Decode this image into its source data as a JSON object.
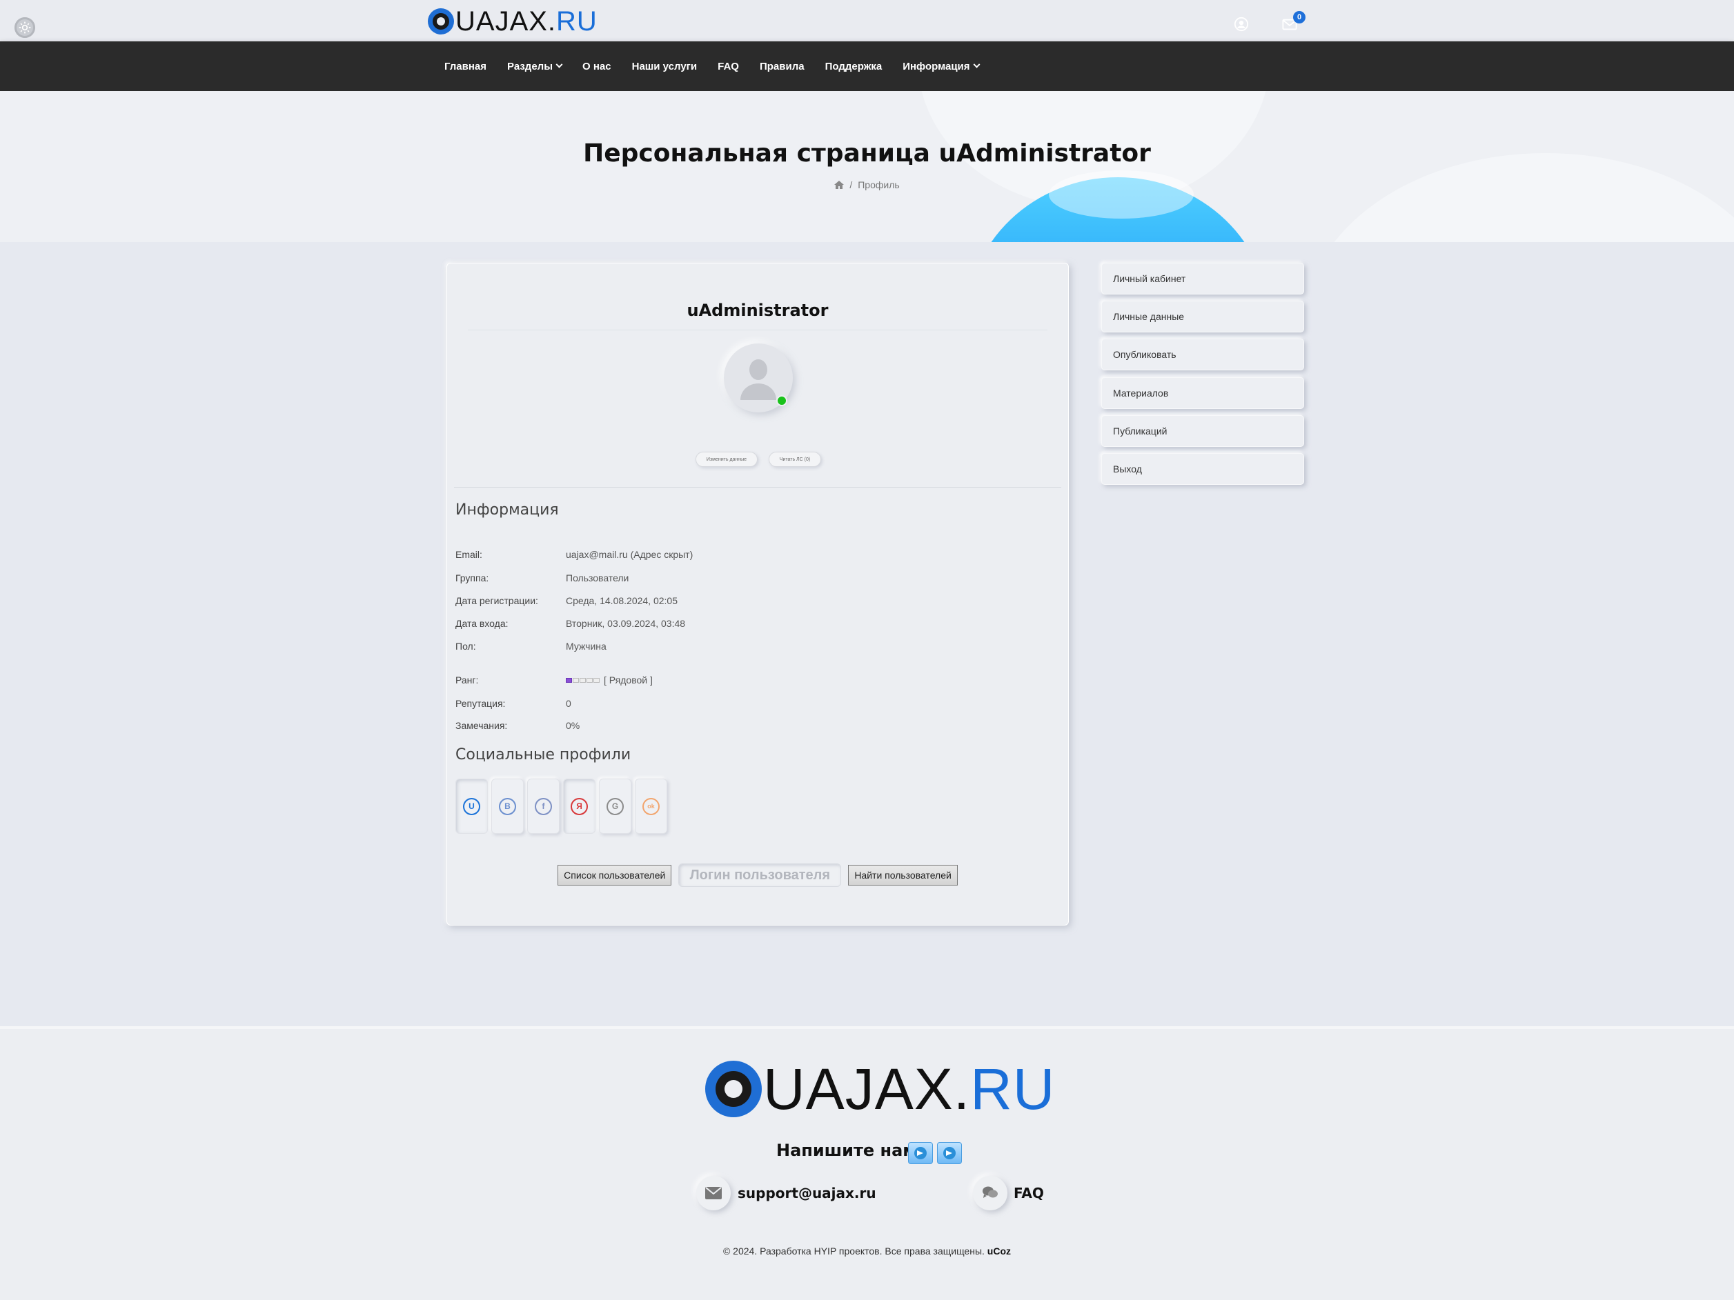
{
  "brand": {
    "name_dark": "UAJAX.",
    "name_blue": "RU"
  },
  "nav": {
    "items": [
      {
        "label": "Главная",
        "dropdown": false
      },
      {
        "label": "Разделы",
        "dropdown": true
      },
      {
        "label": "О нас",
        "dropdown": false
      },
      {
        "label": "Наши услуги",
        "dropdown": false
      },
      {
        "label": "FAQ",
        "dropdown": false
      },
      {
        "label": "Правила",
        "dropdown": false
      },
      {
        "label": "Поддержка",
        "dropdown": false
      },
      {
        "label": "Информация",
        "dropdown": true
      }
    ],
    "user_icon": "user-circle-icon",
    "mail_icon": "envelope-icon",
    "mail_count": "0"
  },
  "hero": {
    "title": "Персональная страница uAdministrator",
    "breadcrumb_home_icon": "home-icon",
    "breadcrumb_sep": "/",
    "breadcrumb_current": "Профиль"
  },
  "profile": {
    "username": "uAdministrator",
    "online": true,
    "buttons": {
      "edit": "Изменить данные",
      "pm": "Читать ЛС (0)"
    },
    "info_heading": "Информация",
    "info_rows": [
      {
        "label": "Email:",
        "value": "uajax@mail.ru (Адрес скрыт)"
      },
      {
        "label": "Группа:",
        "value": "Пользователи"
      },
      {
        "label": "Дата регистрации:",
        "value": "Среда, 14.08.2024, 02:05"
      },
      {
        "label": "Дата входа:",
        "value": "Вторник, 03.09.2024, 03:48"
      },
      {
        "label": "Пол:",
        "value": "Мужчина"
      }
    ],
    "rank": {
      "label": "Ранг:",
      "value": "[ Рядовой ]",
      "level": 1,
      "max": 5,
      "color": "#8a4fd6"
    },
    "stats": [
      {
        "label": "Репутация:",
        "value": "0"
      },
      {
        "label": "Замечания:",
        "value": "0%"
      }
    ],
    "social_heading": "Социальные профили",
    "social": [
      {
        "icon": "ucoz-icon",
        "glyph": "U",
        "color": "#1a72d8",
        "pressed": true
      },
      {
        "icon": "vk-icon",
        "glyph": "В",
        "color": "#6b8fcf",
        "pressed": false
      },
      {
        "icon": "facebook-icon",
        "glyph": "f",
        "color": "#7d90c4",
        "pressed": false
      },
      {
        "icon": "yandex-icon",
        "glyph": "Я",
        "color": "#d8383a",
        "pressed": true
      },
      {
        "icon": "google-icon",
        "glyph": "G",
        "color": "#8b8b8b",
        "pressed": false
      },
      {
        "icon": "odnoklassniki-icon",
        "glyph": "ok",
        "color": "#f2a56e",
        "pressed": false
      }
    ],
    "users_list_btn": "Список пользователей",
    "login_placeholder": "Логин пользователя",
    "find_users_btn": "Найти пользователей"
  },
  "side_menu": [
    "Личный кабинет",
    "Личные данные",
    "Опубликовать",
    "Материалов",
    "Публикаций",
    "Выход"
  ],
  "footer": {
    "write_us": "Напишите нам!",
    "telegram_icons": [
      "telegram-icon",
      "telegram-icon"
    ],
    "email": "support@uajax.ru",
    "faq": "FAQ",
    "copyright": "© 2024. Разработка HYIP проектов. Все права защищены.",
    "copyright_brand": "uCoz"
  }
}
